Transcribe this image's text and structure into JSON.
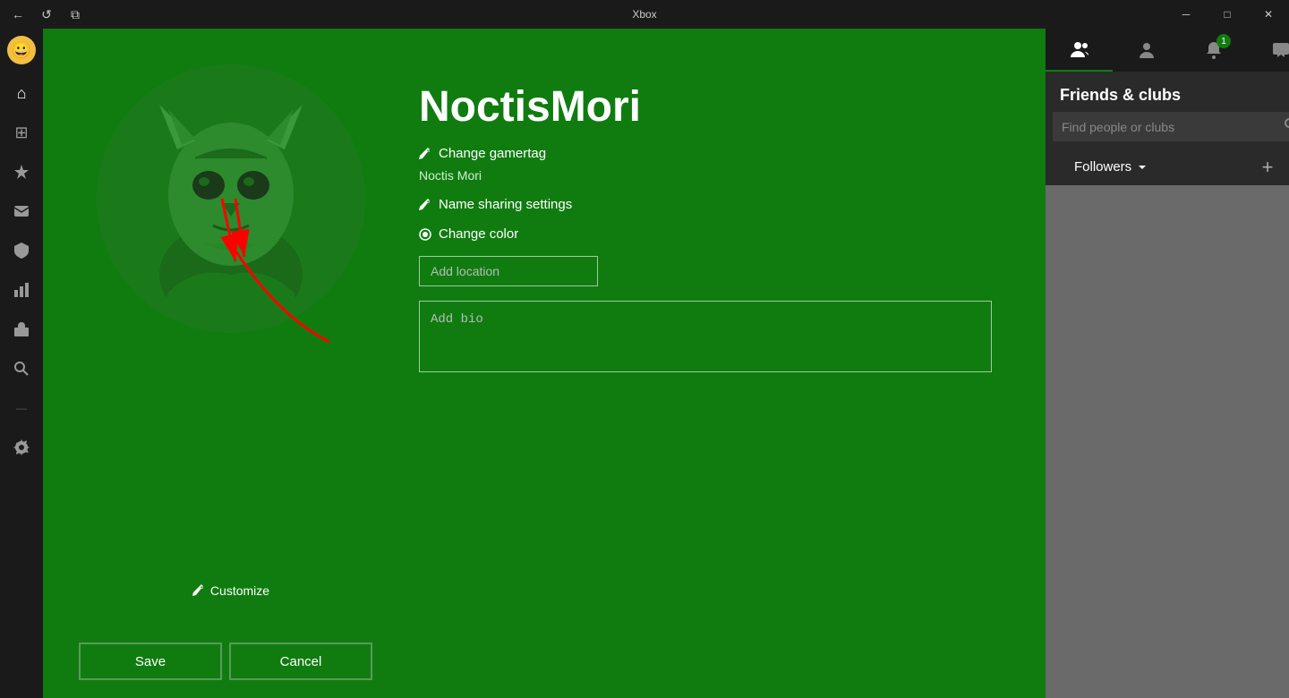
{
  "titlebar": {
    "title": "Xbox",
    "back_label": "←",
    "refresh_label": "↺",
    "capture_label": "⧉",
    "minimize_label": "─",
    "restore_label": "□",
    "close_label": "✕"
  },
  "sidebar": {
    "avatar_emoji": "😀",
    "items": [
      {
        "icon": "⌂",
        "label": "Home",
        "name": "home"
      },
      {
        "icon": "⊞",
        "label": "My games",
        "name": "games"
      },
      {
        "icon": "🏆",
        "label": "Achievements",
        "name": "achievements"
      },
      {
        "icon": "💬",
        "label": "Messages",
        "name": "messages"
      },
      {
        "icon": "🛡",
        "label": "Safety",
        "name": "safety"
      },
      {
        "icon": "📈",
        "label": "Stats",
        "name": "stats"
      },
      {
        "icon": "🏪",
        "label": "Store",
        "name": "store"
      },
      {
        "icon": "🔍",
        "label": "Search",
        "name": "search"
      },
      {
        "icon": "—",
        "label": "Bar",
        "name": "bar"
      },
      {
        "icon": "⚙",
        "label": "Settings",
        "name": "settings"
      }
    ]
  },
  "profile": {
    "gamertag": "NoctisMori",
    "real_name": "Noctis Mori",
    "change_gamertag_label": "Change gamertag",
    "name_sharing_label": "Name sharing settings",
    "change_color_label": "Change color",
    "customize_label": "Customize",
    "location_placeholder": "Add location",
    "bio_placeholder": "Add bio",
    "save_label": "Save",
    "cancel_label": "Cancel"
  },
  "right_sidebar": {
    "title": "Friends & clubs",
    "search_placeholder": "Find people or clubs",
    "followers_label": "Followers",
    "tab_friends_label": "👤",
    "tab_party_label": "👥",
    "tab_notifications_label": "🔔",
    "tab_chat_label": "💬",
    "notification_badge": "1",
    "plus_labels": [
      "+",
      "+",
      "+",
      "+"
    ],
    "add_label": "+"
  }
}
